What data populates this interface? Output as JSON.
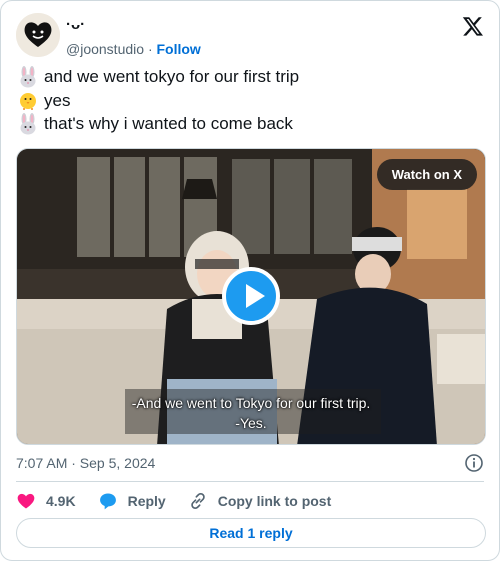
{
  "author": {
    "display_name": "·ᴗ·",
    "handle": "@joonstudio",
    "separator": "·",
    "follow_label": "Follow"
  },
  "tweet": {
    "lines": [
      {
        "emoji": "rabbit-icon",
        "text": "and we went tokyo for our first trip"
      },
      {
        "emoji": "chick-icon",
        "text": "yes"
      },
      {
        "emoji": "rabbit-icon",
        "text": "that's why i wanted to come back"
      }
    ]
  },
  "media": {
    "watch_label": "Watch on X",
    "subtitle_line1": "-And we went to Tokyo for our first trip.",
    "subtitle_line2": "-Yes."
  },
  "meta": {
    "timestamp": "7:07 AM · Sep 5, 2024"
  },
  "actions": {
    "like_count": "4.9K",
    "reply_label": "Reply",
    "copy_label": "Copy link to post"
  },
  "read_reply_label": "Read 1 reply",
  "colors": {
    "link_blue": "#006fd6",
    "play_blue": "#1d9bf0",
    "heart_pink": "#f91880",
    "muted_gray": "#536471",
    "border": "#cfd9de"
  }
}
